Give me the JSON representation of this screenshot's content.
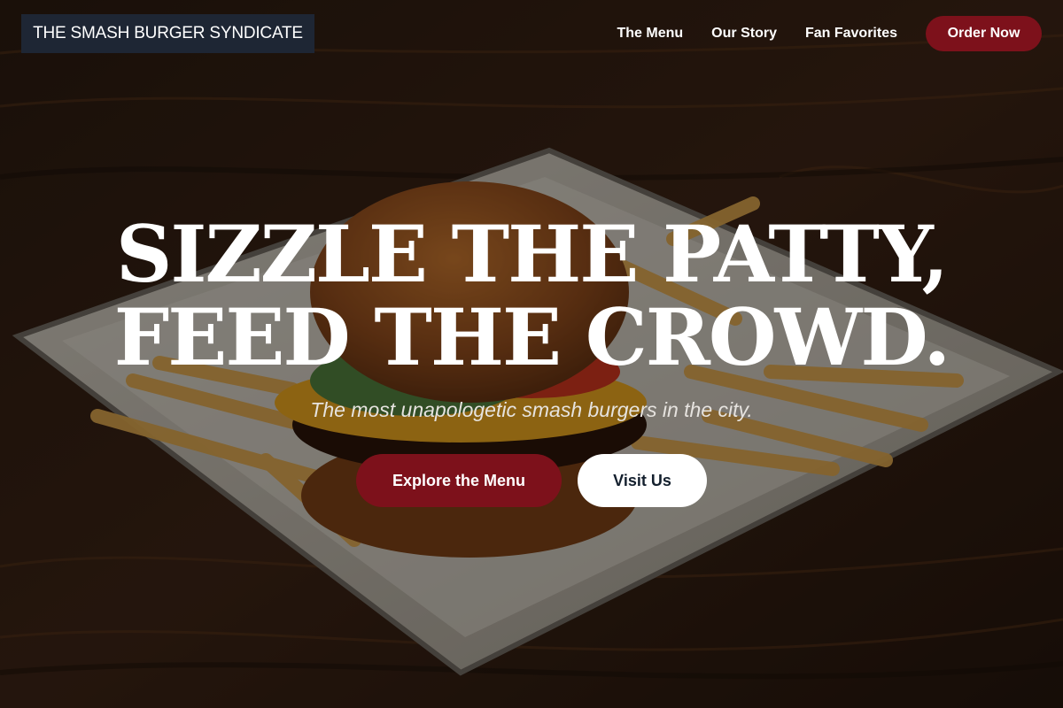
{
  "brand": {
    "name": "THE SMASH BURGER SYNDICATE"
  },
  "nav": {
    "links": [
      "The Menu",
      "Our Story",
      "Fan Favorites"
    ],
    "cta_label": "Order Now"
  },
  "hero": {
    "headline_line1": "SIZZLE THE PATTY,",
    "headline_line2": "FEED THE CROWD.",
    "subheadline": "The most unapologetic smash burgers in the city.",
    "primary_button": "Explore the Menu",
    "secondary_button": "Visit Us"
  },
  "colors": {
    "accent": "#7d111b",
    "logo_bg": "#1e2634",
    "secondary_button_text": "#14202e"
  }
}
